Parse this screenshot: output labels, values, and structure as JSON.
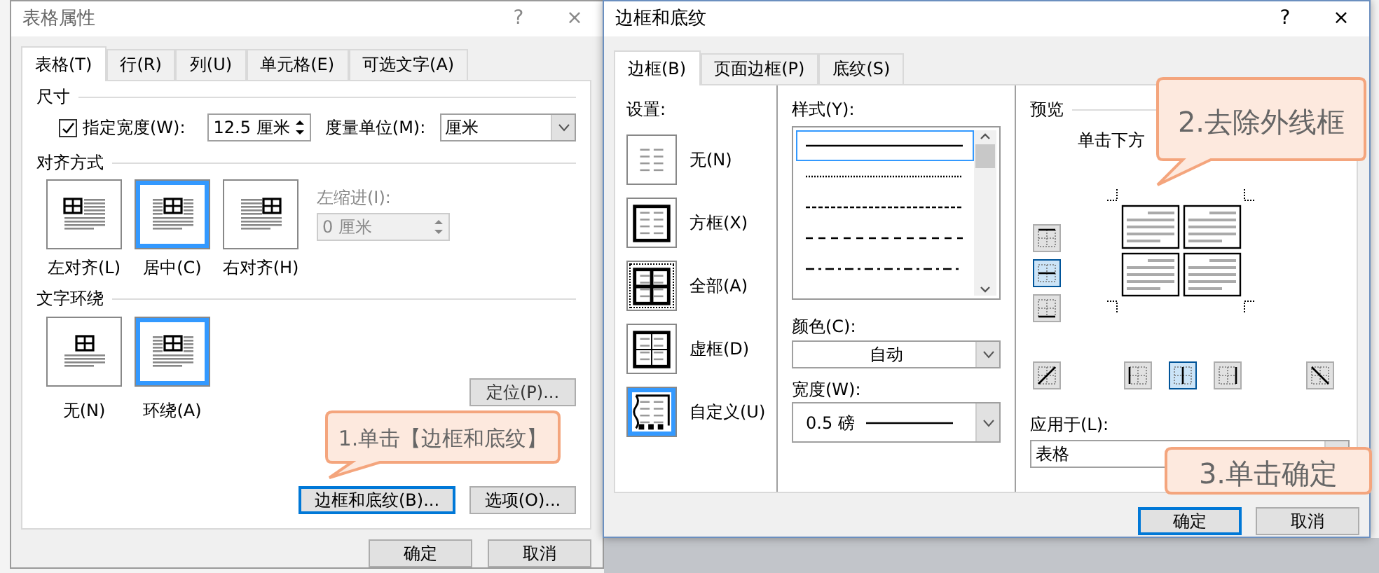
{
  "table_dialog": {
    "title": "表格属性",
    "help": "?",
    "close": "×",
    "tabs": [
      {
        "label": "表格(T)",
        "selected": true
      },
      {
        "label": "行(R)",
        "selected": false
      },
      {
        "label": "列(U)",
        "selected": false
      },
      {
        "label": "单元格(E)",
        "selected": false
      },
      {
        "label": "可选文字(A)",
        "selected": false
      }
    ],
    "size": {
      "heading": "尺寸",
      "width_checkbox": {
        "label": "指定宽度(W):",
        "checked": true
      },
      "width_value": "12.5 厘米",
      "unit_label": "度量单位(M):",
      "unit_value": "厘米"
    },
    "alignment": {
      "heading": "对齐方式",
      "options": [
        {
          "label": "左对齐(L)",
          "kind": "left",
          "selected": false
        },
        {
          "label": "居中(C)",
          "kind": "center",
          "selected": true
        },
        {
          "label": "右对齐(H)",
          "kind": "right",
          "selected": false
        }
      ],
      "indent_label": "左缩进(I):",
      "indent_value": "0 厘米",
      "indent_disabled": true
    },
    "wrapping": {
      "heading": "文字环绕",
      "options": [
        {
          "label": "无(N)",
          "kind": "none",
          "selected": false
        },
        {
          "label": "环绕(A)",
          "kind": "around",
          "selected": true
        }
      ]
    },
    "position_button": "定位(P)...",
    "buttons": [
      {
        "label": "边框和底纹(B)...",
        "focused": true
      },
      {
        "label": "选项(O)...",
        "focused": false
      }
    ],
    "footer_buttons": [
      {
        "label": "确定",
        "focused": false
      },
      {
        "label": "取消",
        "focused": false
      }
    ],
    "callout": "1.单击【边框和底纹】"
  },
  "borders_dialog": {
    "title": "边框和底纹",
    "help": "?",
    "close": "×",
    "tabs": [
      {
        "label": "边框(B)",
        "selected": true
      },
      {
        "label": "页面边框(P)",
        "selected": false
      },
      {
        "label": "底纹(S)",
        "selected": false
      }
    ],
    "settings_label": "设置:",
    "settings": [
      {
        "label": "无(N)",
        "kind": "none",
        "selected": false
      },
      {
        "label": "方框(X)",
        "kind": "box",
        "selected": false
      },
      {
        "label": "全部(A)",
        "kind": "all",
        "selected": false
      },
      {
        "label": "虚框(D)",
        "kind": "grid",
        "selected": false
      },
      {
        "label": "自定义(U)",
        "kind": "custom",
        "selected": true
      }
    ],
    "style_label": "样式(Y):",
    "styles": [
      {
        "kind": "solid",
        "selected": true
      },
      {
        "kind": "dotted",
        "selected": false
      },
      {
        "kind": "dashed",
        "selected": false
      },
      {
        "kind": "long-dash",
        "selected": false
      },
      {
        "kind": "dash-dot",
        "selected": false
      }
    ],
    "color_label": "颜色(C):",
    "color_value": "自动",
    "width_label": "宽度(W):",
    "width_value": "0.5 磅",
    "preview_label": "预览",
    "preview_hint": "单击下方",
    "side_buttons": [
      {
        "kind": "top",
        "selected": false
      },
      {
        "kind": "inner-horizontal",
        "selected": true
      },
      {
        "kind": "bottom",
        "selected": false
      }
    ],
    "bottom_buttons": [
      {
        "kind": "diagonal-up",
        "selected": false
      },
      {
        "kind": "left",
        "selected": false
      },
      {
        "kind": "inner-vertical",
        "selected": true
      },
      {
        "kind": "right",
        "selected": false
      },
      {
        "kind": "diagonal-down",
        "selected": false
      }
    ],
    "apply_label": "应用于(L):",
    "apply_value": "表格",
    "footer_buttons": [
      {
        "label": "确定",
        "focused": true
      },
      {
        "label": "取消",
        "focused": false
      }
    ],
    "callouts": [
      {
        "text": "2.去除外线框",
        "kind": "top"
      },
      {
        "text": "3.单击确定",
        "kind": "bottom"
      }
    ]
  }
}
